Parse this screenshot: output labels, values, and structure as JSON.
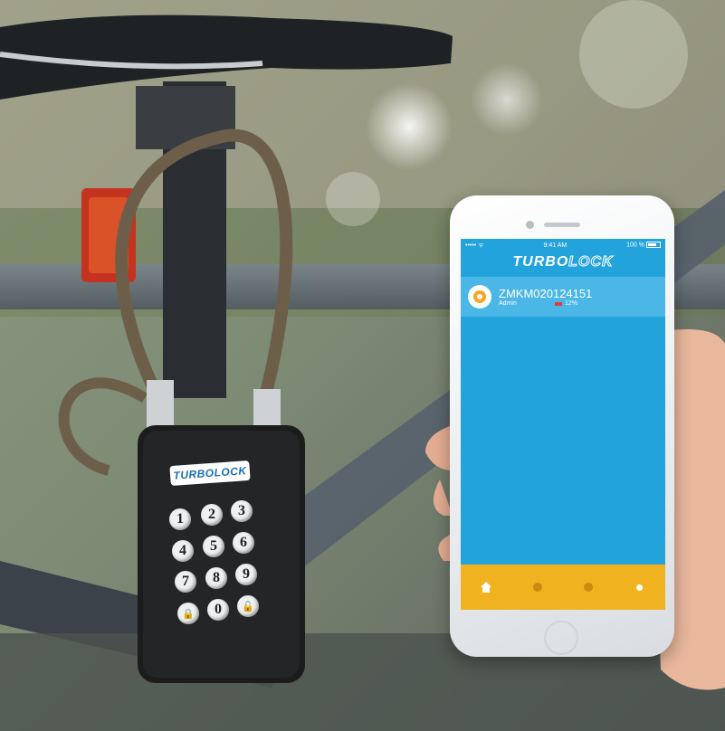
{
  "phone": {
    "status_bar": {
      "carrier": "••••• ᯤ",
      "time": "9:41 AM",
      "battery": "100 %"
    },
    "app_title_part1": "TURBO",
    "app_title_part2": "LOCK",
    "device": {
      "name": "ZMKM020124151",
      "role": "Admin",
      "battery": "12%"
    },
    "tab_icons": [
      "home-icon",
      "dot-icon",
      "dot-icon",
      "settings-icon"
    ]
  },
  "padlock": {
    "logo": "TURBOLOCK",
    "keys": [
      "1",
      "2",
      "3",
      "4",
      "5",
      "6",
      "7",
      "8",
      "9",
      "lock-icon",
      "0",
      "unlock-icon"
    ]
  },
  "colors": {
    "screen_blue": "#23a3dc",
    "tab_yellow": "#f0b21f",
    "accent_orange": "#f5a623"
  }
}
